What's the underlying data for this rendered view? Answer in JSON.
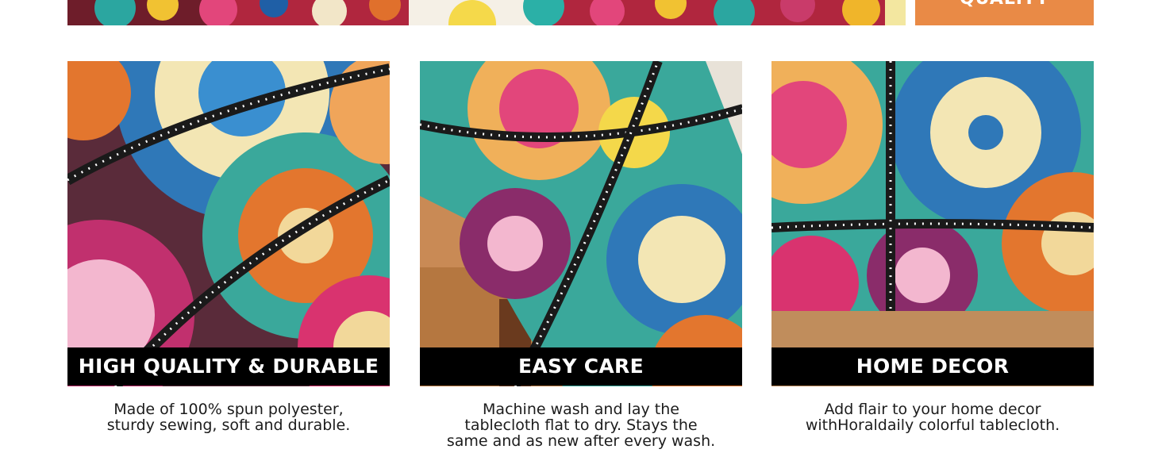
{
  "top": {
    "badge_label": "QUALITY"
  },
  "features": [
    {
      "title": "HIGH QUALITY & DURABLE",
      "description": "Made of 100% spun polyester,\nsturdy sewing, soft and durable."
    },
    {
      "title": "EASY CARE",
      "description": "Machine wash and lay the\ntablecloth flat to dry. Stays the\nsame and as new after every wash."
    },
    {
      "title": "HOME DECOR",
      "description": "Add flair to your home decor\nwithHoraldaily colorful tablecloth."
    }
  ],
  "colors": {
    "badge": "#e98a46",
    "banner": "#000000",
    "text": "#1c1c1c"
  }
}
